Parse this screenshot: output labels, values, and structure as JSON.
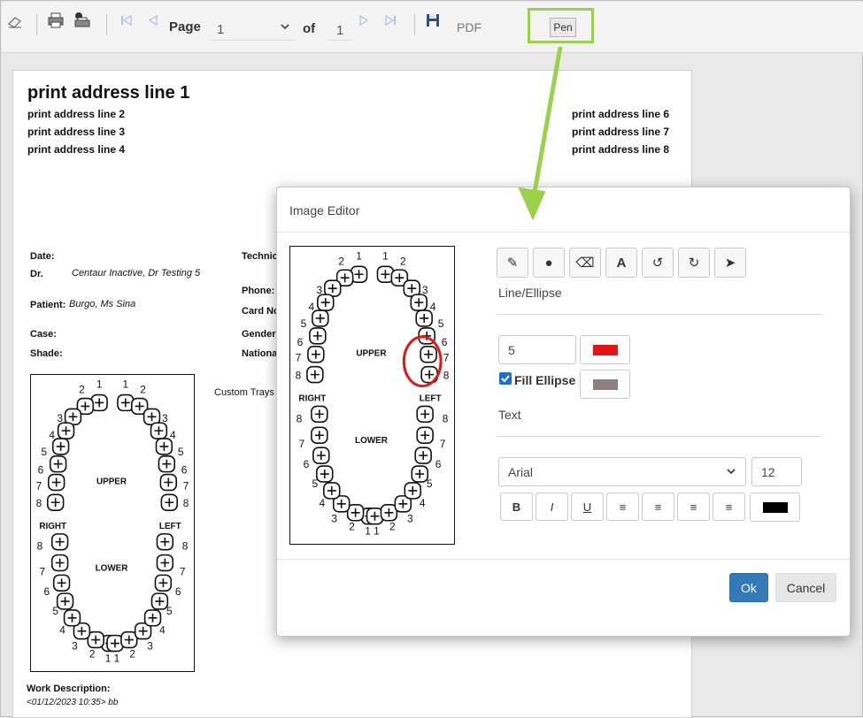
{
  "toolbar": {
    "page_label": "Page",
    "page_value": "1",
    "of_label": "of",
    "total_pages": "1",
    "export_format": "PDF",
    "pen_label": "Pen"
  },
  "report": {
    "address_left": [
      "print address line 1",
      "print address line 2",
      "print address line 3",
      "print address line 4"
    ],
    "address_right": [
      "print address line 6",
      "print address line 7",
      "print address line 8"
    ],
    "fields": {
      "date_label": "Date:",
      "dr_label": "Dr.",
      "dr_value": "Centaur Inactive, Dr Testing  5",
      "patient_label": "Patient:",
      "patient_value": "Burgo, Ms Sina",
      "case_label": "Case:",
      "shade_label": "Shade:",
      "technician_label": "Technic",
      "phone_label": "Phone:",
      "case_no_label": "Card No",
      "gender_label": "Gender",
      "nationality_label": "National",
      "custom_trays": "Custom Trays",
      "work_description_label": "Work Description:",
      "work_description_value": "<01/12/2023 10:35> bb"
    }
  },
  "tooth_chart": {
    "upper_label": "UPPER",
    "lower_label": "LOWER",
    "right_label": "RIGHT",
    "left_label": "LEFT",
    "upper_numbers": [
      "1",
      "2",
      "3",
      "4",
      "5",
      "6",
      "7",
      "8"
    ],
    "lower_numbers": [
      "1",
      "2",
      "3",
      "4",
      "5",
      "6",
      "7",
      "8"
    ]
  },
  "editor": {
    "title": "Image Editor",
    "tools": [
      {
        "name": "pencil-icon",
        "glyph": "✎"
      },
      {
        "name": "circle-icon",
        "glyph": "●"
      },
      {
        "name": "eraser-icon",
        "glyph": "⌫"
      },
      {
        "name": "text-icon",
        "glyph": "A"
      },
      {
        "name": "undo-icon",
        "glyph": "↺"
      },
      {
        "name": "redo-icon",
        "glyph": "↻"
      },
      {
        "name": "pointer-icon",
        "glyph": "➤"
      }
    ],
    "line_section_label": "Line/Ellipse",
    "line_width": "5",
    "line_color": "#e51515",
    "fill_ellipse_label": "Fill Ellipse",
    "fill_ellipse_checked": true,
    "fill_color": "#8c8080",
    "text_section_label": "Text",
    "font_family": "Arial",
    "font_size": "12",
    "format_buttons": [
      {
        "name": "bold-button",
        "glyph": "B"
      },
      {
        "name": "italic-button",
        "glyph": "I"
      },
      {
        "name": "underline-button",
        "glyph": "U"
      },
      {
        "name": "align-left-button",
        "glyph": "≡"
      },
      {
        "name": "align-right-button",
        "glyph": "≡"
      },
      {
        "name": "align-center-button",
        "glyph": "≡"
      },
      {
        "name": "justify-button",
        "glyph": "≡"
      }
    ],
    "text_color": "#000000",
    "ok_label": "Ok",
    "cancel_label": "Cancel"
  },
  "colors": {
    "highlight_green": "#9bd14a",
    "primary_blue": "#337ab7"
  }
}
